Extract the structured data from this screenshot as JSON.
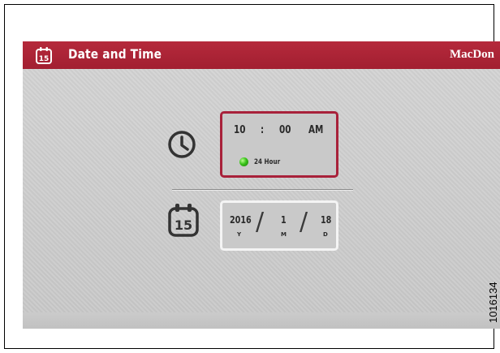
{
  "header": {
    "title": "Date and Time",
    "brand": "MacDon",
    "icon": "calendar-15-icon",
    "background_color": "#a8213a"
  },
  "time": {
    "hour": "10",
    "separator": ":",
    "minute": "00",
    "ampm": "AM",
    "format_label": "24 Hour",
    "format_indicator": "green-led",
    "format_indicator_color": "#38c21a",
    "selected": true,
    "selected_border_color": "#a8213a"
  },
  "date": {
    "year": "2016",
    "month": "1",
    "day": "18",
    "year_unit": "Y",
    "month_unit": "M",
    "day_unit": "D",
    "separator": "/",
    "icon": "calendar-15-icon",
    "calendar_number": "15"
  },
  "icons": {
    "clock": "clock-icon",
    "calendar": "calendar-icon"
  },
  "figure_id": "1016134"
}
